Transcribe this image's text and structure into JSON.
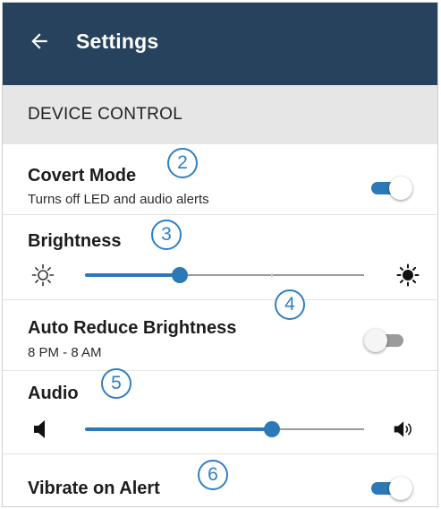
{
  "appbar": {
    "title": "Settings",
    "back_icon": "arrow-left-icon"
  },
  "section": {
    "title": "DEVICE CONTROL"
  },
  "covert_mode": {
    "label": "Covert Mode",
    "description": "Turns off LED and audio alerts",
    "enabled": true,
    "callout": "2"
  },
  "brightness": {
    "label": "Brightness",
    "level": 0.34,
    "callout": "3",
    "low_icon": "sun-outline-icon",
    "high_icon": "sun-filled-icon"
  },
  "auto_reduce": {
    "label": "Auto Reduce Brightness",
    "schedule": "8 PM - 8 AM",
    "enabled": false,
    "callout": "4"
  },
  "audio": {
    "label": "Audio",
    "level": 0.67,
    "callout": "5",
    "low_icon": "speaker-icon",
    "high_icon": "speaker-loud-icon"
  },
  "vibrate": {
    "label": "Vibrate on Alert",
    "enabled": true,
    "callout": "6"
  },
  "colors": {
    "appbar": "#27425c",
    "accent": "#2c79b8",
    "callout": "#2f7fc4",
    "section_bg": "#e6e6e6"
  }
}
